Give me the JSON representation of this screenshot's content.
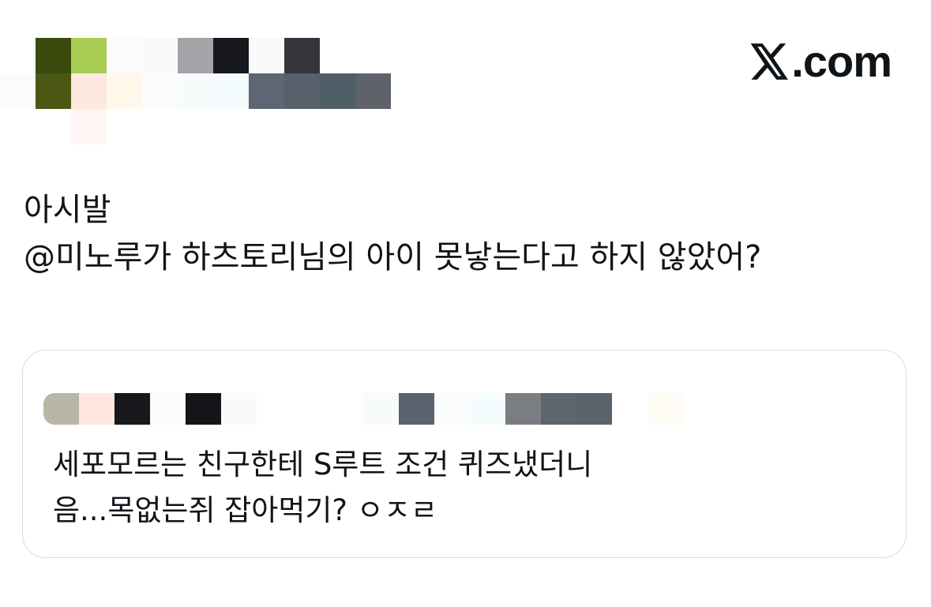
{
  "brand": {
    "name": "X.com",
    "icon": "x-logo-icon"
  },
  "author": {
    "censored": true
  },
  "tweet": {
    "lines": [
      "아시발",
      "@미노루가 하츠토리님의 아이 못낳는다고 하지 않았어?"
    ]
  },
  "quoted_tweet": {
    "author_censored": true,
    "lines": [
      "세포모르는 친구한테 S루트 조건 퀴즈냈더니",
      "음...목없는쥐 잡아먹기? ㅇㅈㄹ"
    ]
  },
  "colors": {
    "text": "#0f1419",
    "border": "#d7dbdf",
    "background": "#ffffff"
  }
}
